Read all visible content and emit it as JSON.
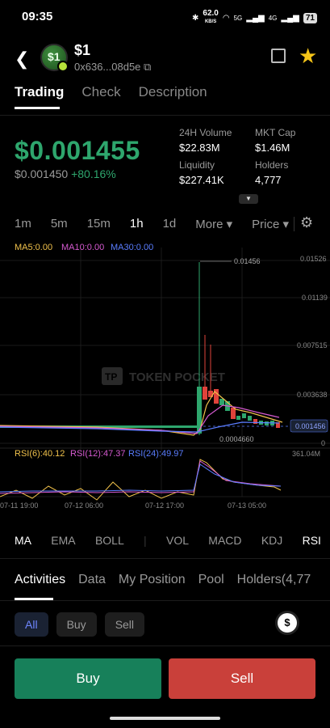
{
  "status": {
    "time": "09:35",
    "net_speed": "62.0",
    "net_unit": "KB/S",
    "sig1": "5G",
    "sig2": "4G",
    "battery": "71"
  },
  "token": {
    "name": "$1",
    "address": "0x636...08d5e"
  },
  "tabs": [
    "Trading",
    "Check",
    "Description"
  ],
  "price": {
    "current": "$0.001455",
    "usd": "$0.001450",
    "change": "+80.16%"
  },
  "stats": {
    "volume_label": "24H Volume",
    "volume": "$22.83M",
    "mcap_label": "MKT Cap",
    "mcap": "$1.46M",
    "liq_label": "Liquidity",
    "liq": "$227.41K",
    "holders_label": "Holders",
    "holders": "4,777"
  },
  "timeframes": [
    "1m",
    "5m",
    "15m",
    "1h",
    "1d",
    "More ▾",
    "Price ▾"
  ],
  "chart": {
    "ma5": "MA5:0.00",
    "ma10": "MA10:0.00",
    "ma30": "MA30:0.00",
    "y_ticks": [
      "0.01526",
      "0.01139",
      "0.007515",
      "0.003638",
      "0"
    ],
    "high_label": "0.01456",
    "low_label": "0.0004660",
    "current_tag": "0.001456",
    "watermark": "TOKEN POCKET",
    "rsi6": "RSI(6):40.12",
    "rsi12": "RSI(12):47.37",
    "rsi24": "RSI(24):49.97",
    "rsi_right": "361.04M",
    "x_ticks": [
      "07-11 19:00",
      "07-12 06:00",
      "07-12 17:00",
      "07-13 05:00"
    ],
    "colors": {
      "up": "#2ea66d",
      "down": "#e0433b",
      "ma5": "#f0c14b",
      "ma10": "#d65ad1",
      "ma30": "#5a7dff"
    }
  },
  "indicators": [
    "MA",
    "EMA",
    "BOLL",
    "VOL",
    "MACD",
    "KDJ",
    "RSI"
  ],
  "activities": [
    "Activities",
    "Data",
    "My Position",
    "Pool",
    "Holders(4,77"
  ],
  "filters": [
    "All",
    "Buy",
    "Sell"
  ],
  "currency_icon": "$",
  "actions": {
    "buy": "Buy",
    "sell": "Sell"
  }
}
